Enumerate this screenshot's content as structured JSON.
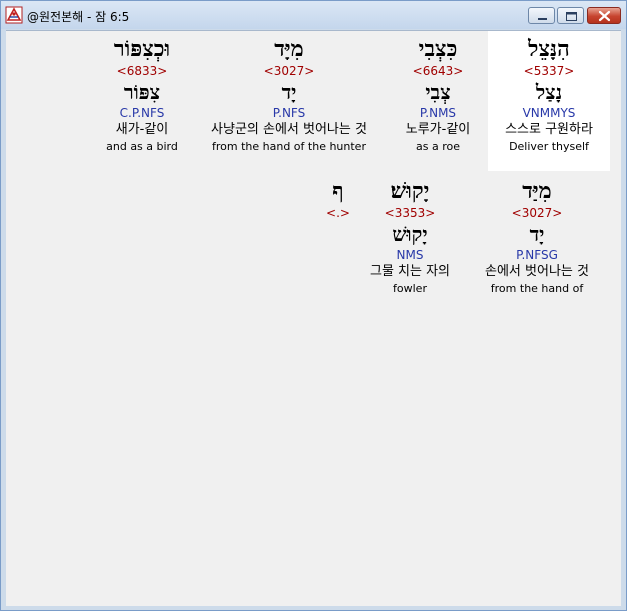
{
  "window": {
    "title": "@원전본해 - 잠 6:5"
  },
  "rows": [
    {
      "words": [
        {
          "hebrew": "הִנָּצֵל",
          "strong": "<5337>",
          "lemma": "נָצַל",
          "morph": "VNMMYS",
          "korean": "스스로 구원하라",
          "english": "Deliver thyself",
          "selected": true
        },
        {
          "hebrew": "כִּצְבִי",
          "strong": "<6643>",
          "lemma": "צְבִי",
          "morph": "P.NMS",
          "korean": "노루가-같이",
          "english": "as a roe",
          "selected": false
        },
        {
          "hebrew": "מִיָּד",
          "strong": "<3027>",
          "lemma": "יָד",
          "morph": "P.NFS",
          "korean": "사냥군의 손에서 벗어나는 것",
          "english": "from the hand of the hunter",
          "selected": false
        },
        {
          "hebrew": "וּכְצִפּוֹר",
          "strong": "<6833>",
          "lemma": "צִפּוֹר",
          "morph": "C.P.NFS",
          "korean": "새가-같이",
          "english": "and as a bird",
          "selected": false
        }
      ]
    },
    {
      "words": [
        {
          "hebrew": "מִיַּד",
          "strong": "<3027>",
          "lemma": "יָד",
          "morph": "P.NFSG",
          "korean": "손에서 벗어나는 것",
          "english": "from the hand of"
        },
        {
          "hebrew": "יָקוּשׁ׃",
          "strong": "<3353>",
          "lemma": "יָקוּשׁ",
          "morph": "NMS",
          "korean": "그물 치는 자의",
          "english": "fowler"
        },
        {
          "hebrew": "ף",
          "strong": "<.>",
          "lemma": "",
          "morph": "",
          "korean": "",
          "english": ""
        }
      ]
    }
  ]
}
